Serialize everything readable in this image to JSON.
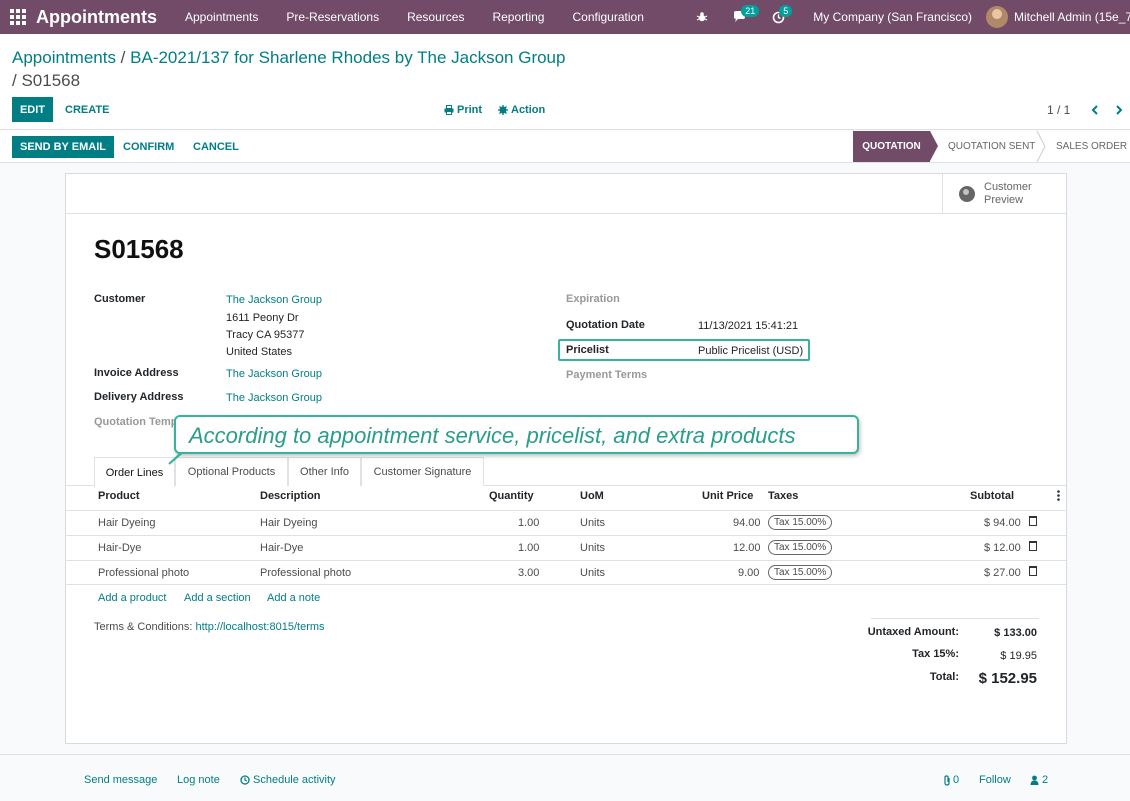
{
  "navbar": {
    "brand": "Appointments",
    "menu": [
      "Appointments",
      "Pre-Reservations",
      "Resources",
      "Reporting",
      "Configuration"
    ],
    "messages_count": "21",
    "activities_count": "5",
    "company": "My Company (San Francisco)",
    "user": "Mitchell Admin (15e_7"
  },
  "breadcrumb": {
    "root": "Appointments",
    "parent": "BA-2021/137 for Sharlene Rhodes by The Jackson Group",
    "current": "S01568"
  },
  "control": {
    "edit_label": "EDIT",
    "create_label": "CREATE",
    "print_label": "Print",
    "action_label": "Action",
    "pager": "1 / 1"
  },
  "status": {
    "send_email": "SEND BY EMAIL",
    "confirm": "CONFIRM",
    "cancel": "CANCEL",
    "stages": [
      "QUOTATION",
      "QUOTATION SENT",
      "SALES ORDER"
    ]
  },
  "sheet": {
    "preview_label": "Customer Preview",
    "order_name": "S01568",
    "customer_label": "Customer",
    "customer_name": "The Jackson Group",
    "address_1": "1611 Peony Dr",
    "address_2": "Tracy CA 95377",
    "address_3": "United States",
    "invoice_label": "Invoice Address",
    "invoice_value": "The Jackson Group",
    "delivery_label": "Delivery Address",
    "delivery_value": "The Jackson Group",
    "template_label": "Quotation Temp",
    "expiration_label": "Expiration",
    "quotation_date_label": "Quotation Date",
    "quotation_date": "11/13/2021 15:41:21",
    "pricelist_label": "Pricelist",
    "pricelist_value": "Public Pricelist (USD)",
    "payment_terms_label": "Payment Terms"
  },
  "tabs": [
    "Order Lines",
    "Optional Products",
    "Other Info",
    "Customer Signature"
  ],
  "table": {
    "headers": [
      "Product",
      "Description",
      "Quantity",
      "UoM",
      "Unit Price",
      "Taxes",
      "Subtotal"
    ],
    "rows": [
      {
        "product": "Hair Dyeing",
        "description": "Hair Dyeing",
        "qty": "1.00",
        "uom": "Units",
        "price": "94.00",
        "tax": "Tax 15.00%",
        "subtotal": "$ 94.00"
      },
      {
        "product": "Hair-Dye",
        "description": "Hair-Dye",
        "qty": "1.00",
        "uom": "Units",
        "price": "12.00",
        "tax": "Tax 15.00%",
        "subtotal": "$ 12.00"
      },
      {
        "product": "Professional photo",
        "description": "Professional photo",
        "qty": "3.00",
        "uom": "Units",
        "price": "9.00",
        "tax": "Tax 15.00%",
        "subtotal": "$ 27.00"
      }
    ],
    "add_product": "Add a product",
    "add_section": "Add a section",
    "add_note": "Add a note"
  },
  "terms": {
    "label": "Terms & Conditions:",
    "url": "http://localhost:8015/terms"
  },
  "totals": {
    "untaxed_label": "Untaxed Amount:",
    "untaxed_value": "$ 133.00",
    "tax_label": "Tax 15%:",
    "tax_value": "$ 19.95",
    "total_label": "Total:",
    "total_value": "$ 152.95"
  },
  "callout": {
    "text": "According to appointment service, pricelist, and extra products"
  },
  "chatter": {
    "send_message": "Send message",
    "log_note": "Log note",
    "schedule": "Schedule activity",
    "attachments": "0",
    "follow": "Follow",
    "followers": "2"
  },
  "colors": {
    "brand": "#714b67",
    "accent": "#017e84",
    "highlight": "#36b39d"
  }
}
